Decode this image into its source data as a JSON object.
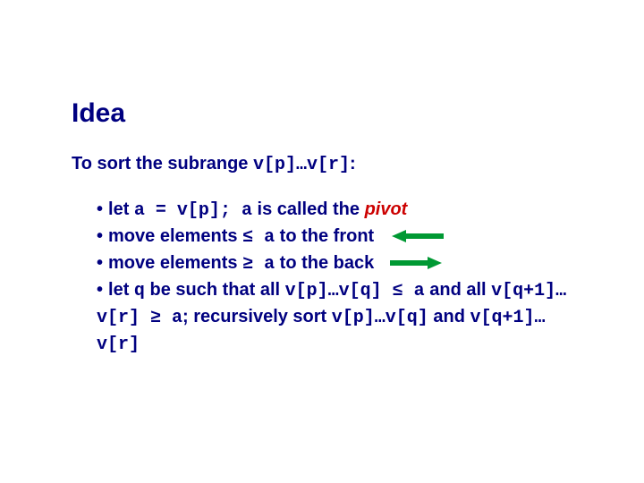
{
  "title": "Idea",
  "lede_pre": "To sort the subrange ",
  "lede_code": "v[p]…v[r]",
  "lede_post": ":",
  "b1_pre": "let ",
  "b1_code1": "a = v[p]; a",
  "b1_mid": " is called the ",
  "b1_pivot": "pivot",
  "b2_pre": "move elements ",
  "b2_code": "≤ a",
  "b2_post": " to the front",
  "b3_pre": "move elements ",
  "b3_code": "≥ a",
  "b3_post": " to the back",
  "b4_pre": "let ",
  "b4_q": "q",
  "b4_mid1": " be such that all ",
  "b4_code1": "v[p]…v[q] ≤ a",
  "b4_mid2": " and all ",
  "b4_code2": "v[q+1]…v[r] ≥ a",
  "b4_mid3": "; recursively sort ",
  "b4_code3": "v[p]…v[q]",
  "b4_and": " and ",
  "b4_code4": "v[q+1]…v[r]",
  "bullet": "•"
}
